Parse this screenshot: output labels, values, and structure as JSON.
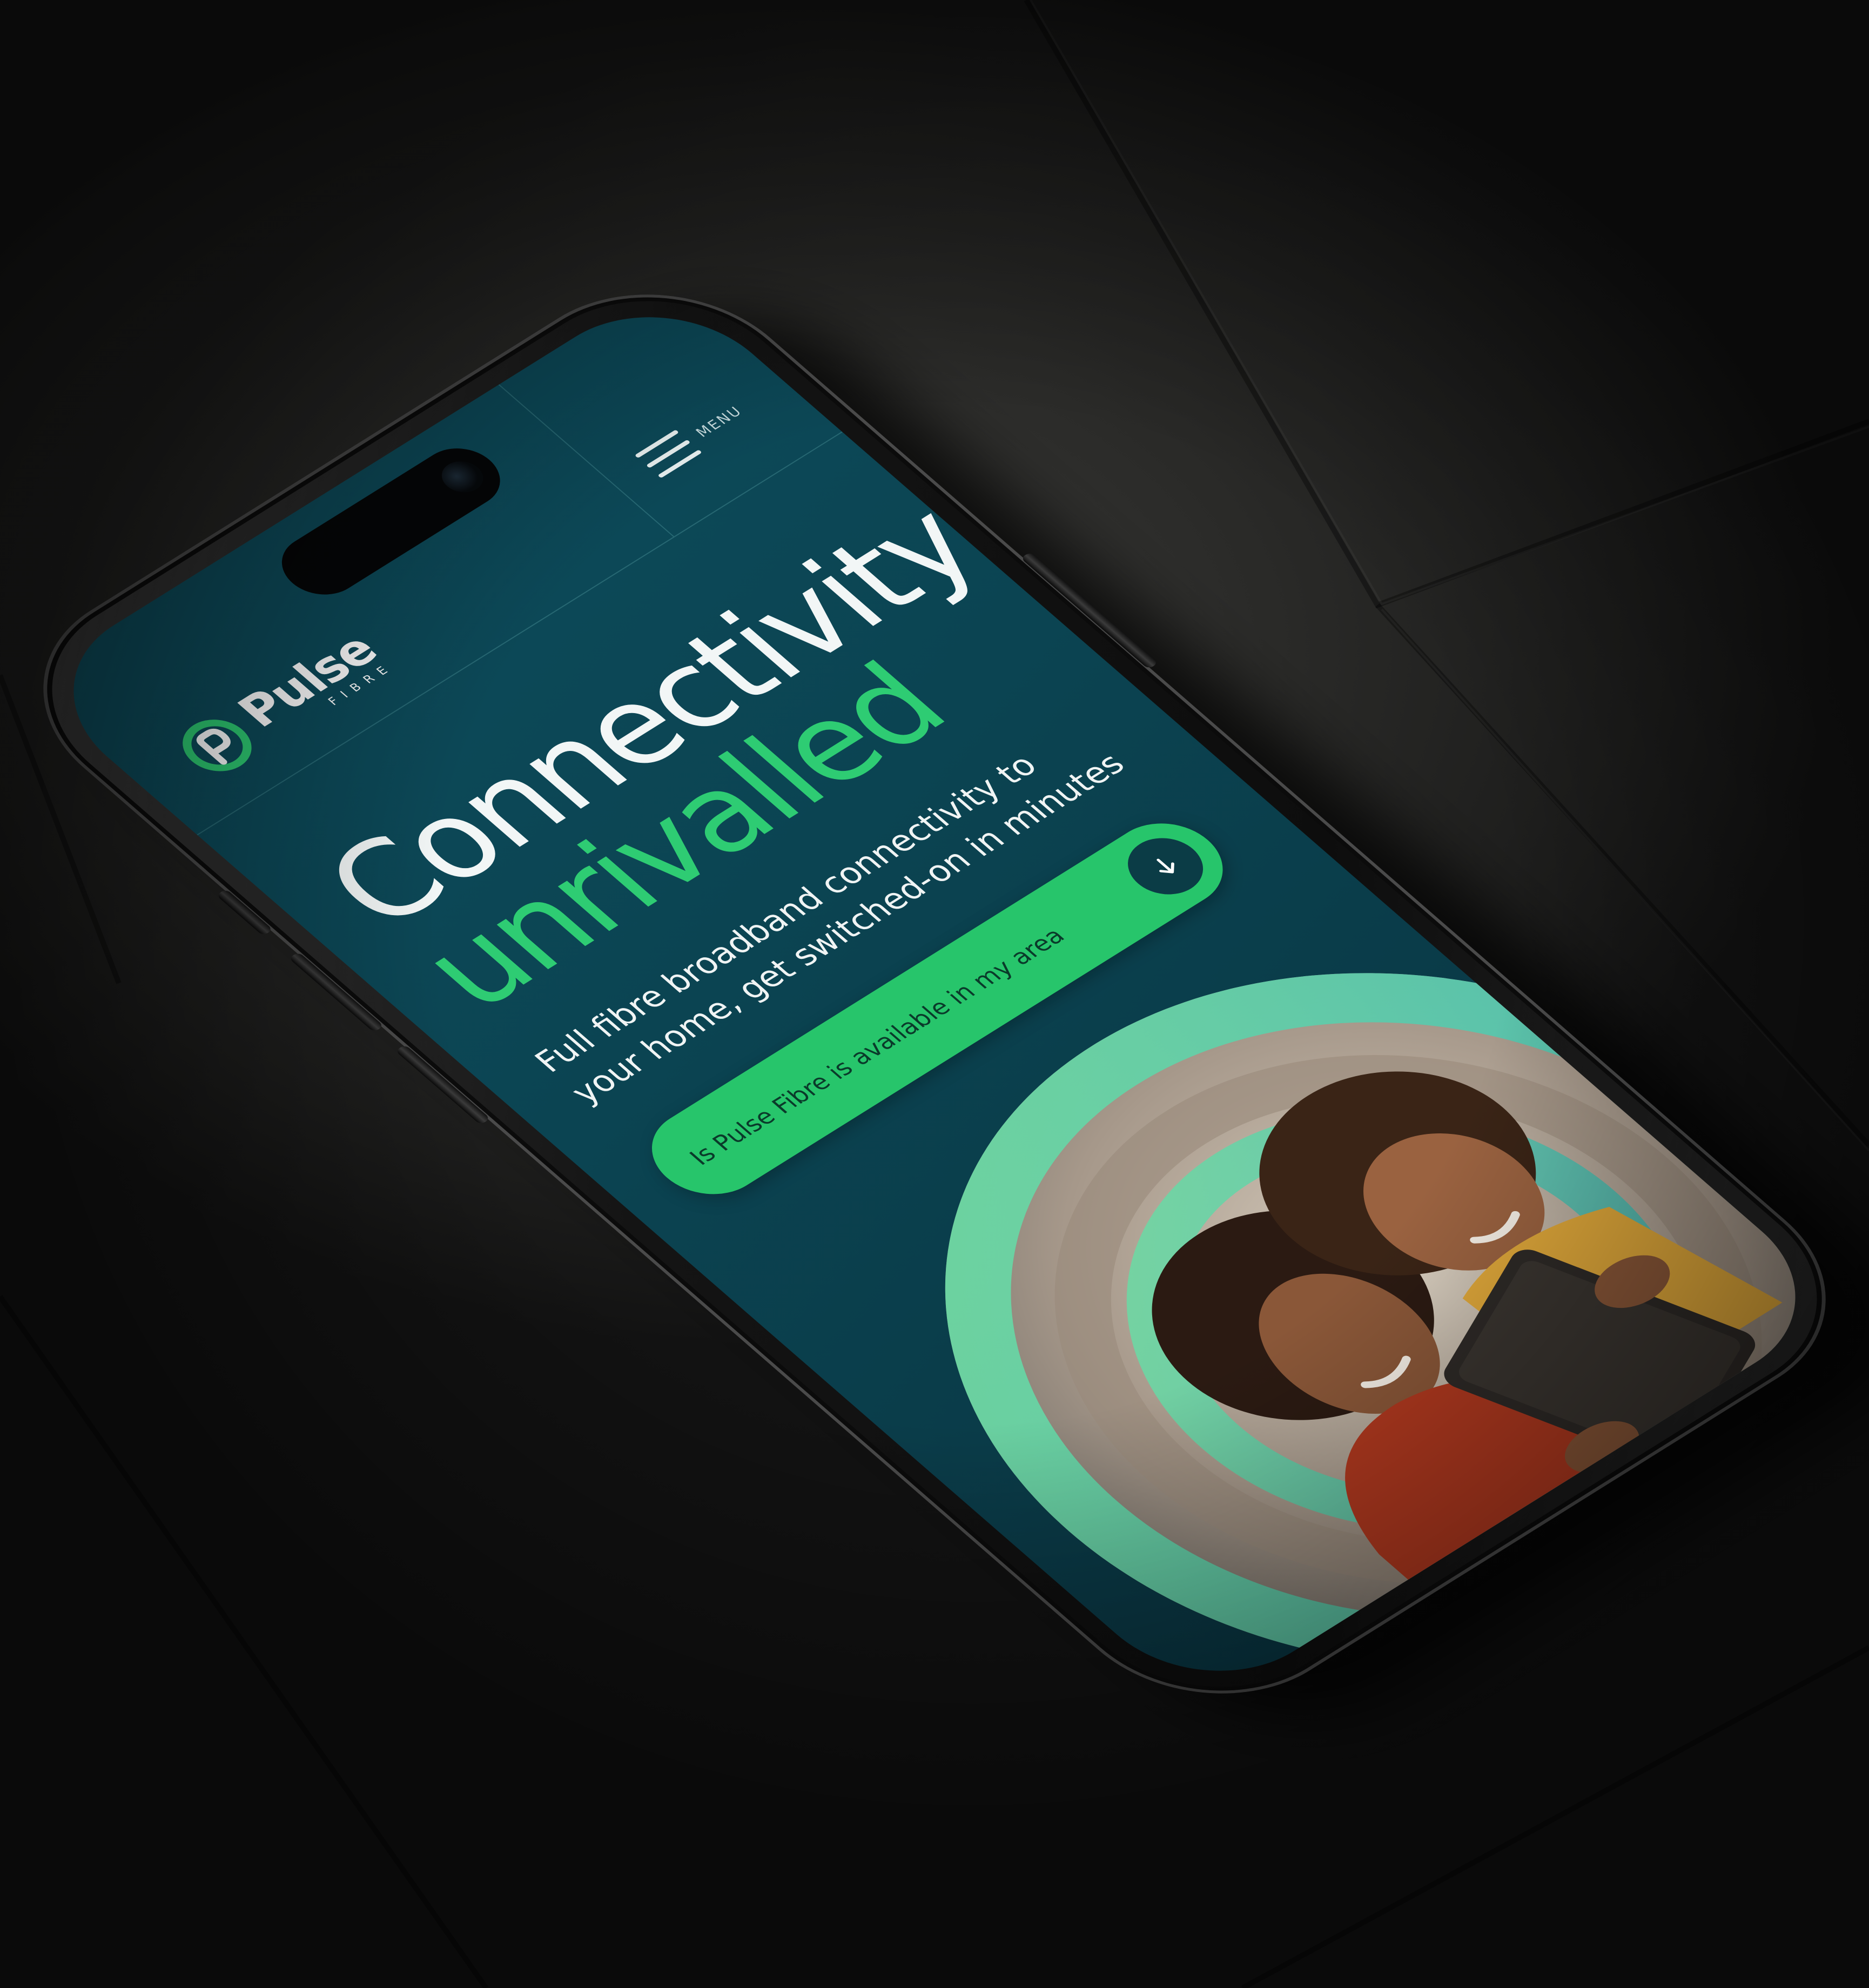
{
  "brand": {
    "name": "Pulse",
    "tagline": "FIBRE"
  },
  "header": {
    "menu_label": "MENU"
  },
  "hero": {
    "title_line1": "Connectivity",
    "title_line2": "unrivalled",
    "subtitle": "Full fibre broadband connectivity to your home, get switched-on in minutes",
    "cta_label": "Is Pulse Fibre is available in my area"
  },
  "colors": {
    "screen_background": "#0b4452",
    "accent_green": "#2ecc73",
    "cta_background": "#27c56b",
    "cta_icon_background": "#0b3c46",
    "scene_background": "#2a2a28"
  },
  "icons": {
    "logo": "pulse-p-logo-icon",
    "menu": "hamburger-icon",
    "cta": "arrow-down-icon"
  }
}
